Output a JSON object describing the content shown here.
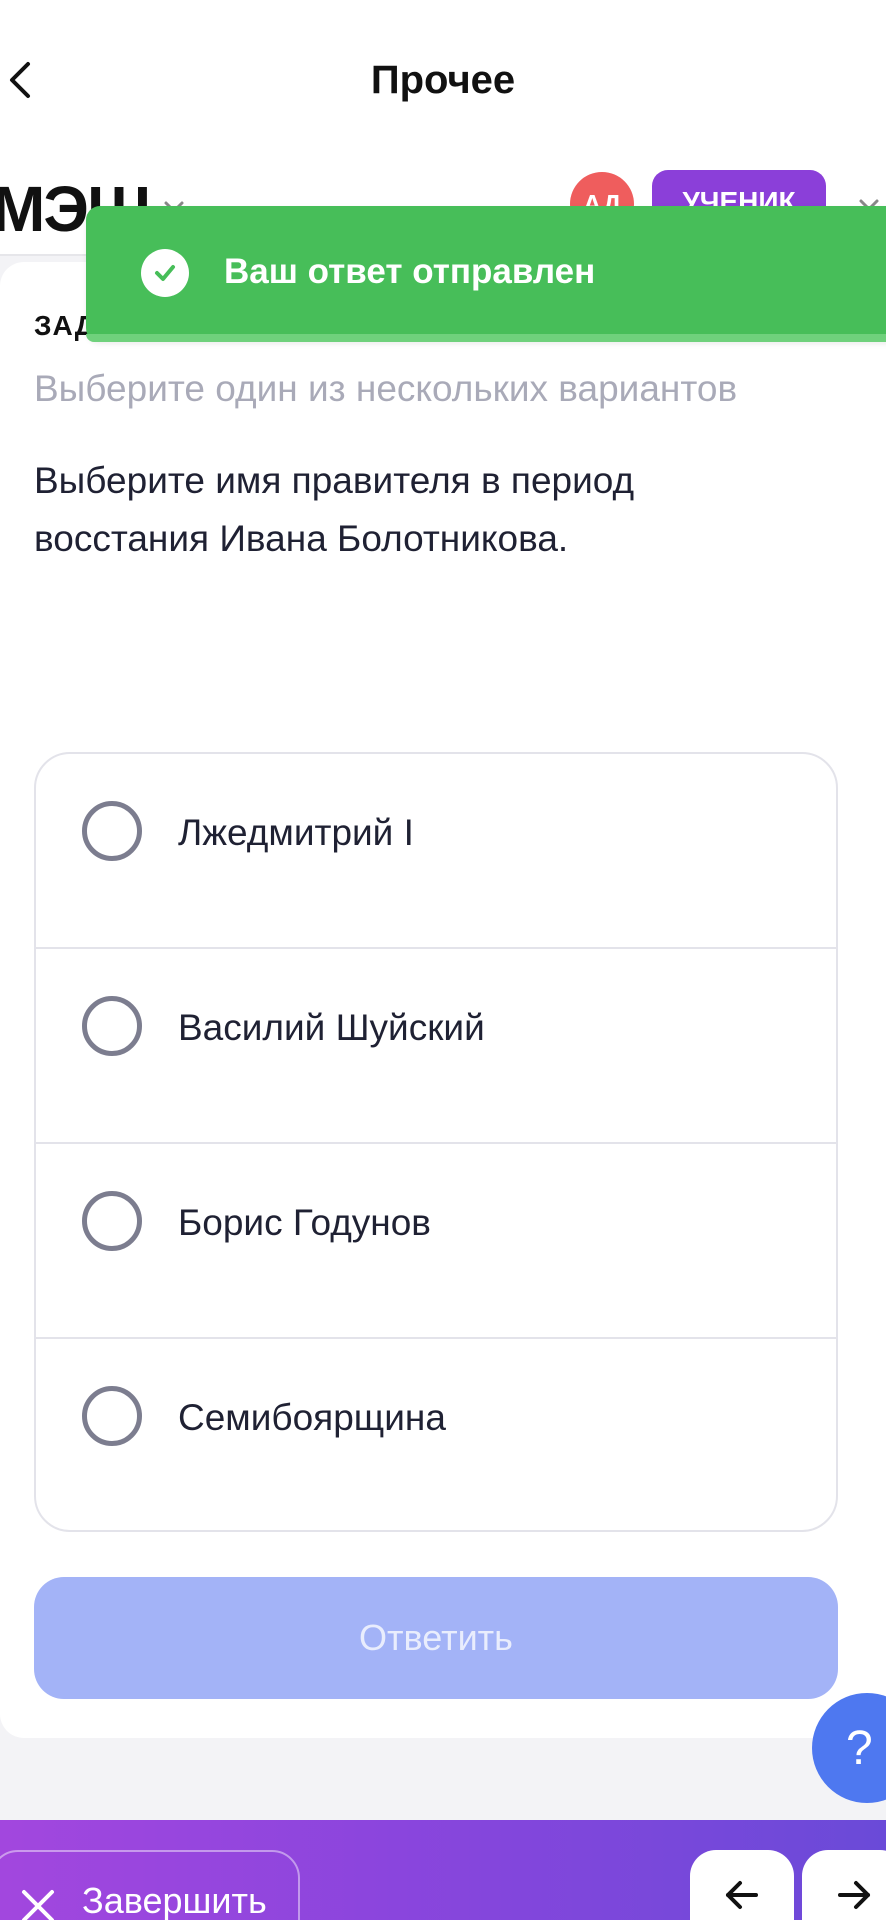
{
  "nav": {
    "title": "Прочее",
    "back_icon": "chevron-left-icon"
  },
  "app_header": {
    "logo_text": "МЭШ",
    "avatar_initials": "АД",
    "role_badge": "УЧЕНИК"
  },
  "toast": {
    "message": "Ваш ответ отправлен",
    "icon": "check-circle-icon",
    "color": "#47be59"
  },
  "task": {
    "label": "ЗАДАНИЕ",
    "instruction": "Выберите один из нескольких вариантов",
    "question": "Выберите имя правителя в период восстания Ивана Болотникова.",
    "options": [
      {
        "label": "Лжедмитрий I",
        "selected": false
      },
      {
        "label": "Василий Шуйский",
        "selected": false
      },
      {
        "label": "Борис Годунов",
        "selected": false
      },
      {
        "label": "Семибоярщина",
        "selected": false
      }
    ],
    "submit_label": "Ответить",
    "submit_color": "#a3b3f7"
  },
  "help": {
    "label": "?"
  },
  "bottom_bar": {
    "finish_label": "Завершить",
    "finish_icon": "close-icon",
    "prev_icon": "arrow-left-icon",
    "next_icon": "arrow-right-icon"
  }
}
